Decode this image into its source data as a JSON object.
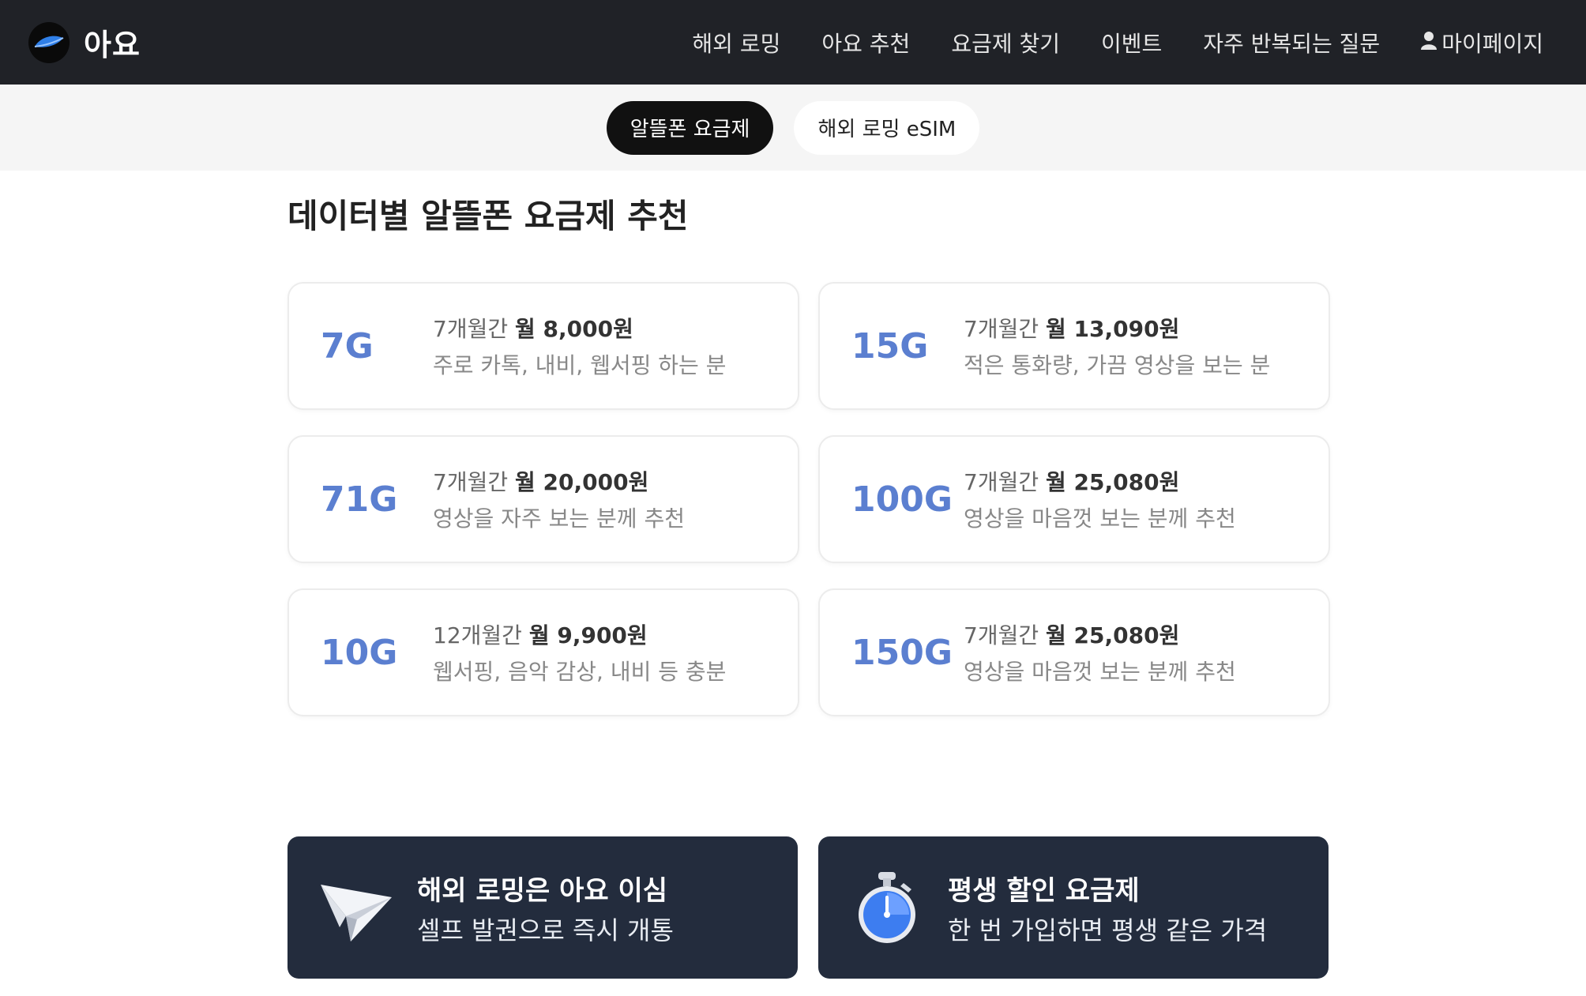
{
  "header": {
    "logo_text": "아요",
    "nav": [
      {
        "label": "해외 로밍"
      },
      {
        "label": "아요 추천"
      },
      {
        "label": "요금제 찾기"
      },
      {
        "label": "이벤트"
      },
      {
        "label": "자주 반복되는 질문"
      },
      {
        "label": "마이페이지",
        "icon": "user-icon"
      }
    ]
  },
  "tabs": [
    {
      "label": "알뜰폰 요금제",
      "active": true
    },
    {
      "label": "해외 로밍 eSIM",
      "active": false
    }
  ],
  "main": {
    "title": "데이터별 알뜰폰 요금제 추천",
    "plans": [
      {
        "data": "7G",
        "period": "7개월간",
        "price": "월 8,000원",
        "desc": "주로 카톡, 내비, 웹서핑 하는 분"
      },
      {
        "data": "15G",
        "period": "7개월간",
        "price": "월 13,090원",
        "desc": "적은 통화량, 가끔 영상을 보는 분"
      },
      {
        "data": "71G",
        "period": "7개월간",
        "price": "월 20,000원",
        "desc": "영상을 자주 보는 분께 추천"
      },
      {
        "data": "100G",
        "period": "7개월간",
        "price": "월 25,080원",
        "desc": "영상을 마음껏 보는 분께 추천"
      },
      {
        "data": "10G",
        "period": "12개월간",
        "price": "월 9,900원",
        "desc": "웹서핑, 음악 감상, 내비 등 충분"
      },
      {
        "data": "150G",
        "period": "7개월간",
        "price": "월 25,080원",
        "desc": "영상을 마음껏 보는 분께 추천"
      }
    ]
  },
  "promos": [
    {
      "title": "해외 로밍은 아요 이심",
      "subtitle": "셀프 발권으로 즉시 개통",
      "icon": "paper-plane-icon"
    },
    {
      "title": "평생 할인 요금제",
      "subtitle": "한 번 가입하면 평생 같은 가격",
      "icon": "stopwatch-icon"
    }
  ],
  "colors": {
    "header_bg": "#202227",
    "accent_blue": "#5b7fd0",
    "promo_bg": "#232c3d",
    "active_tab_bg": "#111111"
  }
}
